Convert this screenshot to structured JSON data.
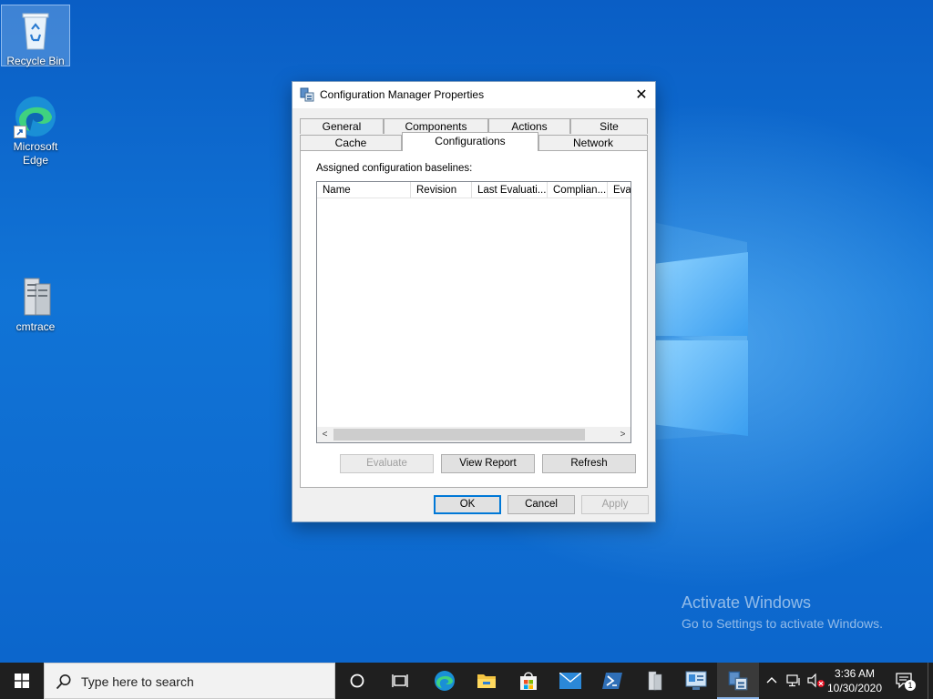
{
  "desktop": {
    "icons": [
      {
        "label": "Recycle Bin"
      },
      {
        "label": "Microsoft Edge"
      },
      {
        "label": "cmtrace"
      }
    ],
    "watermark": {
      "title": "Activate Windows",
      "subtitle": "Go to Settings to activate Windows."
    }
  },
  "dialog": {
    "title": "Configuration Manager Properties",
    "tabs_row1": [
      "General",
      "Components",
      "Actions",
      "Site"
    ],
    "tabs_row2": [
      "Cache",
      "Configurations",
      "Network"
    ],
    "active_tab": "Configurations",
    "assigned_label": "Assigned configuration baselines:",
    "columns": [
      "Name",
      "Revision",
      "Last Evaluati...",
      "Complian...",
      "Eva"
    ],
    "panel_buttons": {
      "evaluate": "Evaluate",
      "view_report": "View Report",
      "refresh": "Refresh"
    },
    "footer_buttons": {
      "ok": "OK",
      "cancel": "Cancel",
      "apply": "Apply"
    }
  },
  "taskbar": {
    "search_placeholder": "Type here to search",
    "time": "3:36 AM",
    "date": "10/30/2020",
    "notification_count": "1"
  },
  "colors": {
    "accent": "#0078d7",
    "taskbar": "#1f1f1f",
    "desktop": "#0a63c9"
  }
}
